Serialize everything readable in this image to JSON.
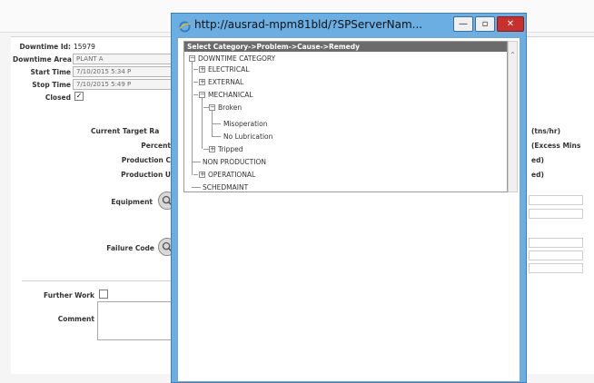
{
  "form": {
    "downtime_id_label": "Downtime Id:",
    "downtime_id_value": "15979",
    "downtime_area_label": "Downtime Area",
    "downtime_area_value": "PLANT A",
    "start_time_label": "Start Time",
    "start_time_value": "7/10/2015 5:34 P",
    "stop_time_label": "Stop Time",
    "stop_time_value": "7/10/2015 5:49 P",
    "closed_label": "Closed",
    "closed_checked": "✓",
    "current_target_label": "Current Target Ra",
    "percent_label": "Percent",
    "production_c_label": "Production C",
    "production_u_label": "Production U",
    "equipment_label": "Equipment",
    "failure_code_label": "Failure Code",
    "further_work_label": "Further Work",
    "comment_label": "Comment",
    "right_unit_1": "(tns/hr)",
    "right_unit_2": "(Excess Mins",
    "right_unit_3": "ed)",
    "right_unit_4": "ed)"
  },
  "popup": {
    "title": "http://ausrad-mpm81bld/?SPServerNam...",
    "minimize_label": "—",
    "maximize_label": "▫",
    "close_label": "✕",
    "header": "Select Category->Problem->Cause->Remedy",
    "tree": {
      "root": "DOWNTIME CATEGORY",
      "electrical": "ELECTRICAL",
      "external": "EXTERNAL",
      "mechanical": "MECHANICAL",
      "broken": "Broken",
      "misoperation": "Misoperation",
      "no_lubrication": "No Lubrication",
      "tripped": "Tripped",
      "non_production": "NON PRODUCTION",
      "operational": "OPERATIONAL",
      "schedmaint": "SCHEDMAINT"
    }
  },
  "colors": {
    "window_frame": "#6aaee2",
    "close_button": "#c9302c",
    "tree_header": "#6b6b6b"
  }
}
